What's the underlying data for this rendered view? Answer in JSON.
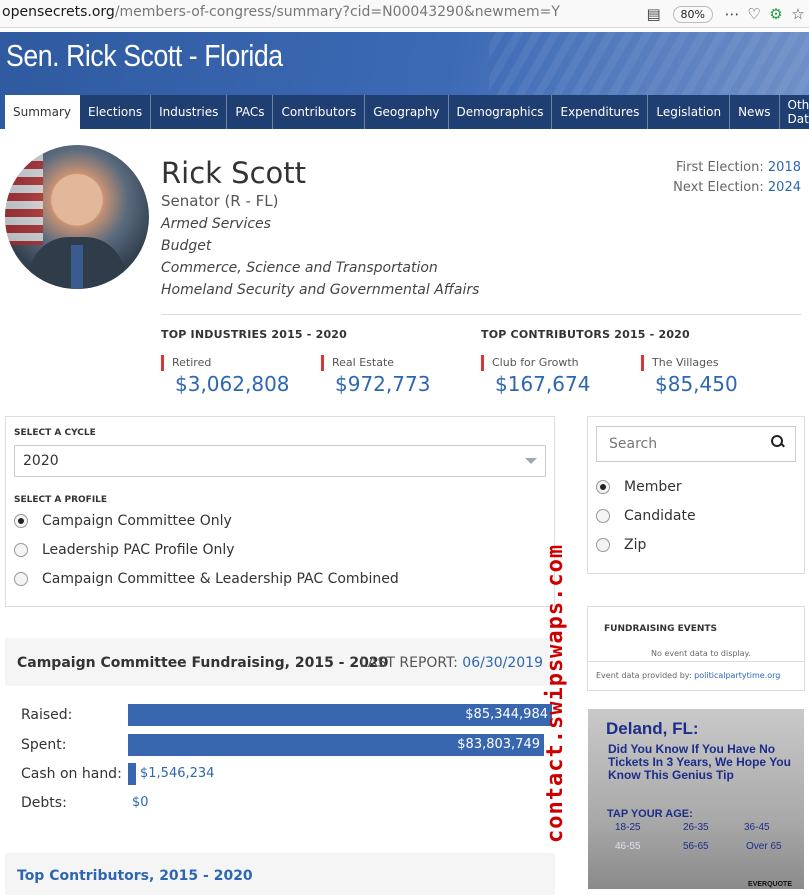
{
  "browser": {
    "url_host": "opensecrets.org",
    "url_path": "/members-of-congress/summary?cid=N00043290&newmem=Y",
    "zoom": "80%"
  },
  "header": {
    "title": "Sen. Rick Scott - Florida",
    "tabs": [
      "Summary",
      "Elections",
      "Industries",
      "PACs",
      "Contributors",
      "Geography",
      "Demographics",
      "Expenditures",
      "Legislation",
      "News",
      "Other Data"
    ],
    "active_tab": "Summary"
  },
  "profile": {
    "name": "Rick Scott",
    "title": "Senator (R - FL)",
    "committees": [
      "Armed Services",
      "Budget",
      "Commerce, Science and Transportation",
      "Homeland Security and Governmental Affairs"
    ],
    "first_election_label": "First Election:",
    "first_election": "2018",
    "next_election_label": "Next Election:",
    "next_election": "2024"
  },
  "top_industries": {
    "heading": "TOP INDUSTRIES 2015 - 2020",
    "items": [
      {
        "label": "Retired",
        "amount": "$3,062,808"
      },
      {
        "label": "Real Estate",
        "amount": "$972,773"
      }
    ]
  },
  "top_contributors": {
    "heading": "TOP CONTRIBUTORS 2015 - 2020",
    "items": [
      {
        "label": "Club for Growth",
        "amount": "$167,674"
      },
      {
        "label": "The Villages",
        "amount": "$85,450"
      }
    ]
  },
  "cycle": {
    "label": "SELECT A CYCLE",
    "value": "2020",
    "profile_label": "SELECT A PROFILE",
    "profiles": [
      "Campaign Committee Only",
      "Leadership PAC Profile Only",
      "Campaign Committee & Leadership PAC Combined"
    ],
    "selected_profile": 0
  },
  "search": {
    "placeholder": "Search",
    "options": [
      "Member",
      "Candidate",
      "Zip"
    ],
    "selected": 0
  },
  "fundraising_events": {
    "heading": "FUNDRAISING EVENTS",
    "empty": "No event data to display.",
    "provided_by": "Event data provided by:",
    "provider": "politicalpartytime.org"
  },
  "ad": {
    "city": "Deland, FL:",
    "text": "Did You Know If You Have No Tickets In 3 Years, We Hope You Know This Genius Tip",
    "tap": "TAP YOUR AGE:",
    "ages": [
      "18-25",
      "26-35",
      "36-45",
      "46-55",
      "56-65",
      "Over 65"
    ],
    "brand": "EVERQUOTE"
  },
  "campaign": {
    "heading": "Campaign Committee Fundraising, 2015 - 2020",
    "last_report_label": "LAST REPORT:",
    "last_report": "06/30/2019",
    "rows": [
      {
        "label": "Raised:",
        "value": "$85,344,984",
        "fraction": 1.0
      },
      {
        "label": "Spent:",
        "value": "$83,803,749",
        "fraction": 0.982
      },
      {
        "label": "Cash on hand:",
        "value": "$1,546,234",
        "fraction": 0.018
      },
      {
        "label": "Debts:",
        "value": "$0",
        "fraction": 0
      }
    ]
  },
  "top_contributors_section": {
    "heading": "Top Contributors, 2015 - 2020"
  },
  "watermark": "contact.swipswaps.com"
}
